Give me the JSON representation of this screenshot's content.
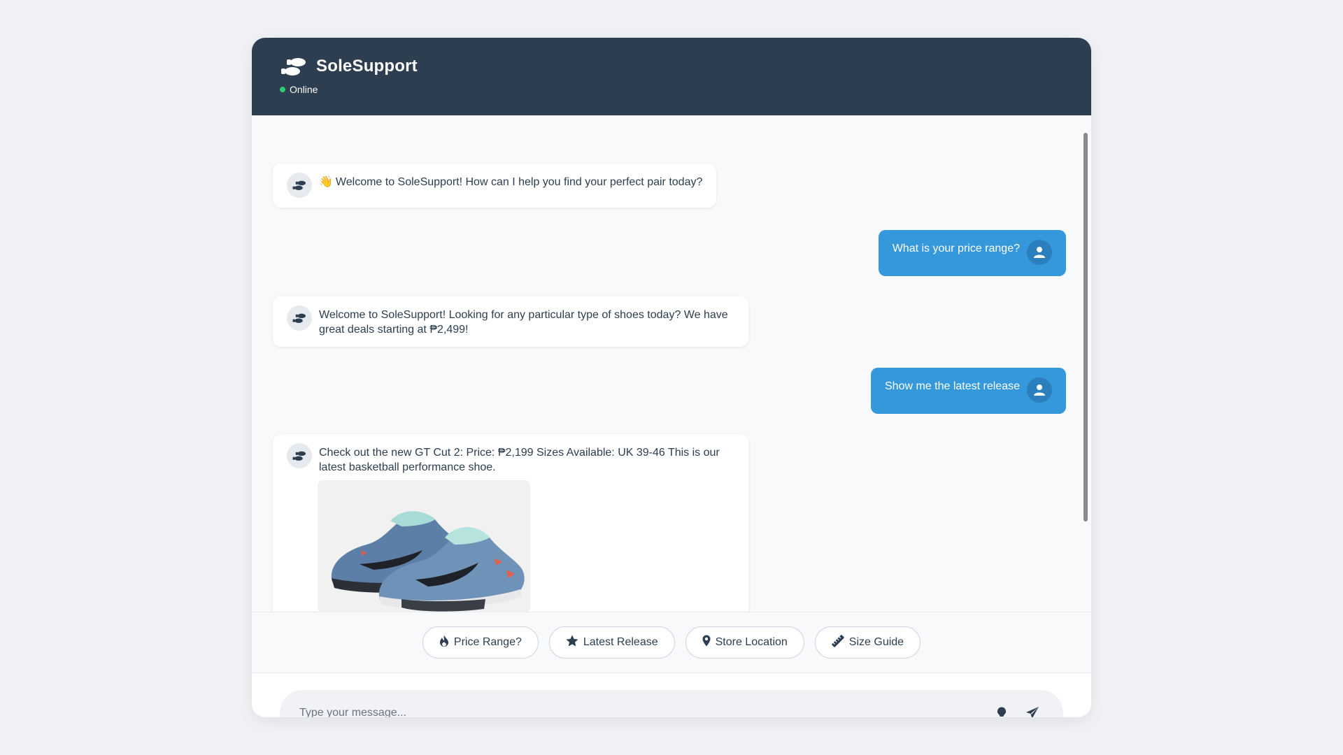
{
  "header": {
    "brand_name": "SoleSupport",
    "status": "Online"
  },
  "messages": [
    {
      "sender": "bot",
      "emoji": "👋",
      "text": "Welcome to SoleSupport! How can I help you find your perfect pair today?"
    },
    {
      "sender": "user",
      "text": "What is your price range?"
    },
    {
      "sender": "bot",
      "text": "Welcome to SoleSupport! Looking for any particular type of shoes today? We have great deals starting at ₱2,499!"
    },
    {
      "sender": "user",
      "text": "Show me the latest release"
    },
    {
      "sender": "bot",
      "text": "Check out the new GT Cut 2: Price: ₱2,199 Sizes Available: UK 39-46 This is our latest basketball performance shoe.",
      "image": "basketball-shoe-image"
    }
  ],
  "quick_replies": [
    {
      "label": "Price Range?",
      "icon": "fire-icon"
    },
    {
      "label": "Latest Release",
      "icon": "star-icon"
    },
    {
      "label": "Store Location",
      "icon": "map-pin-icon"
    },
    {
      "label": "Size Guide",
      "icon": "ruler-icon"
    }
  ],
  "input": {
    "placeholder": "Type your message...",
    "value": ""
  },
  "colors": {
    "header_bg": "#2c3e50",
    "accent": "#3498db",
    "status_online": "#2ecc71",
    "page_bg": "#f0f2f5"
  }
}
